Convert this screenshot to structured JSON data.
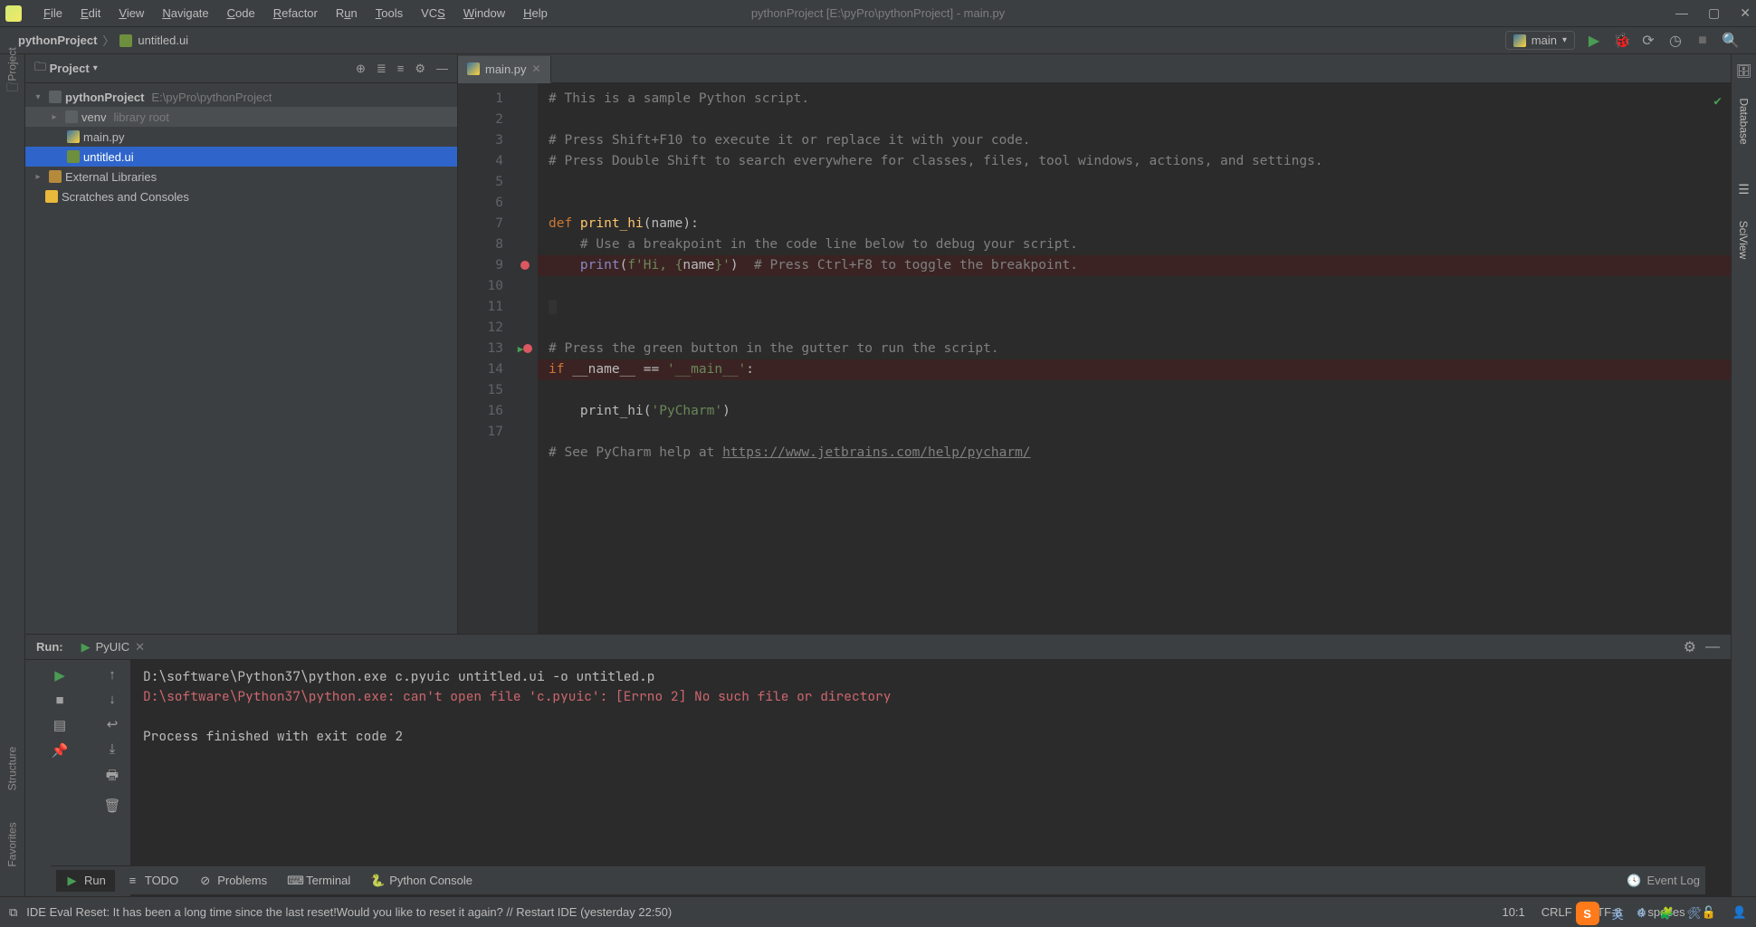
{
  "window": {
    "title": "pythonProject [E:\\pyPro\\pythonProject] - main.py",
    "menu": [
      "File",
      "Edit",
      "View",
      "Navigate",
      "Code",
      "Refactor",
      "Run",
      "Tools",
      "VCS",
      "Window",
      "Help"
    ]
  },
  "breadcrumb": {
    "project": "pythonProject",
    "file": "untitled.ui"
  },
  "run_config": {
    "label": "main"
  },
  "project_panel": {
    "title": "Project",
    "root": {
      "name": "pythonProject",
      "path": "E:\\pyPro\\pythonProject"
    },
    "venv": {
      "name": "venv",
      "suffix": "library root"
    },
    "files": [
      "main.py",
      "untitled.ui"
    ],
    "ext_lib": "External Libraries",
    "scratches": "Scratches and Consoles"
  },
  "editor": {
    "tab": "main.py",
    "lines": [
      "1",
      "2",
      "3",
      "4",
      "5",
      "6",
      "7",
      "8",
      "9",
      "10",
      "11",
      "12",
      "13",
      "14",
      "15",
      "16",
      "17"
    ],
    "l1": "# This is a sample Python script.",
    "l3": "# Press Shift+F10 to execute it or replace it with your code.",
    "l4": "# Press Double Shift to search everywhere for classes, files, tool windows, actions, and settings.",
    "l7_def": "def ",
    "l7_fn": "print_hi",
    "l7_rest": "(name):",
    "l8": "    # Use a breakpoint in the code line below to debug your script.",
    "l9_pre": "    ",
    "l9_fn": "print",
    "l9_open": "(",
    "l9_str1": "f'Hi, {",
    "l9_name": "name",
    "l9_str2": "}'",
    "l9_close": ")  ",
    "l9_cm": "# Press Ctrl+F8 to toggle the breakpoint.",
    "l12": "# Press the green button in the gutter to run the script.",
    "l13_if": "if ",
    "l13_name": "__name__",
    "l13_eq": " == ",
    "l13_str": "'__main__'",
    "l13_colon": ":",
    "l14_pre": "    print_hi(",
    "l14_str": "'PyCharm'",
    "l14_close": ")",
    "l16_pre": "# See PyCharm help at ",
    "l16_url": "https://www.jetbrains.com/help/pycharm/"
  },
  "run_panel": {
    "label": "Run:",
    "tab": "PyUIC",
    "line1": "D:\\software\\Python37\\python.exe c.pyuic untitled.ui -o untitled.p",
    "line2": "D:\\software\\Python37\\python.exe: can't open file 'c.pyuic': [Errno 2] No such file or directory",
    "line3": "Process finished with exit code 2"
  },
  "bottom_tabs": {
    "run": "Run",
    "todo": "TODO",
    "problems": "Problems",
    "terminal": "Terminal",
    "pyconsole": "Python Console",
    "eventlog": "Event Log"
  },
  "status": {
    "message": "IDE Eval Reset: It has been a long time since the last reset!Would you like to reset it again? // Restart IDE (yesterday 22:50)",
    "pos": "10:1",
    "line_sep": "CRLF",
    "encoding": "UTF-8",
    "indent": "4 spaces"
  },
  "side_tabs": {
    "left_top": "Project",
    "left_struct": "Structure",
    "left_fav": "Favorites",
    "right_db": "Database",
    "right_sci": "SciView"
  }
}
